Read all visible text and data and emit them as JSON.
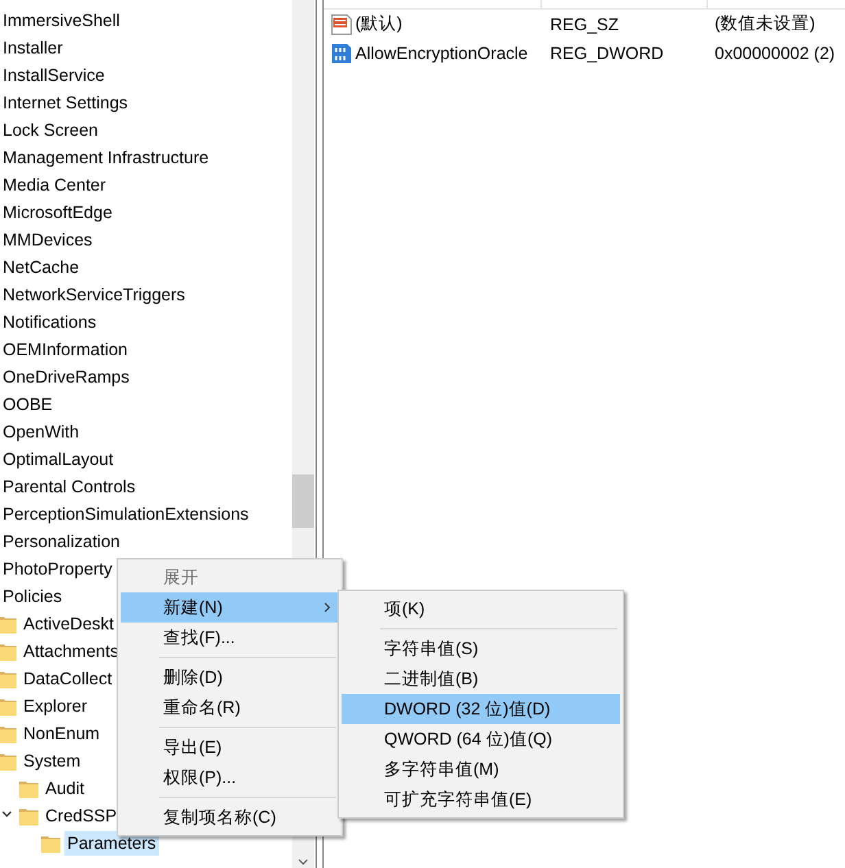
{
  "tree": [
    {
      "label": "ImmersiveShell",
      "selected": false
    },
    {
      "label": "Installer",
      "selected": false
    },
    {
      "label": "InstallService",
      "selected": false
    },
    {
      "label": "Internet Settings",
      "selected": false
    },
    {
      "label": "Lock Screen",
      "selected": false
    },
    {
      "label": "Management Infrastructure",
      "selected": false
    },
    {
      "label": "Media Center",
      "selected": false
    },
    {
      "label": "MicrosoftEdge",
      "selected": false
    },
    {
      "label": "MMDevices",
      "selected": false
    },
    {
      "label": "NetCache",
      "selected": false
    },
    {
      "label": "NetworkServiceTriggers",
      "selected": false
    },
    {
      "label": "Notifications",
      "selected": false
    },
    {
      "label": "OEMInformation",
      "selected": false
    },
    {
      "label": "OneDriveRamps",
      "selected": false
    },
    {
      "label": "OOBE",
      "selected": false
    },
    {
      "label": "OpenWith",
      "selected": false
    },
    {
      "label": "OptimalLayout",
      "selected": false
    },
    {
      "label": "Parental Controls",
      "selected": false
    },
    {
      "label": "PerceptionSimulationExtensions",
      "selected": false
    },
    {
      "label": "Personalization",
      "selected": false
    },
    {
      "label": "PhotoProperty",
      "selected": false
    },
    {
      "label": "Policies",
      "selected": false,
      "children": [
        {
          "label": "ActiveDeskt",
          "selected": false
        },
        {
          "label": "Attachments",
          "selected": false
        },
        {
          "label": "DataCollect",
          "selected": false
        },
        {
          "label": "Explorer",
          "selected": false
        },
        {
          "label": "NonEnum",
          "selected": false
        },
        {
          "label": "System",
          "selected": false,
          "children": [
            {
              "label": "Audit",
              "selected": false
            },
            {
              "label": "CredSSP",
              "selected": false,
              "expanded": true,
              "children": [
                {
                  "label": "Parameters",
                  "selected": true
                }
              ]
            }
          ]
        }
      ]
    }
  ],
  "values": [
    {
      "kind": "string",
      "name": "(默认)",
      "type": "REG_SZ",
      "data": "(数值未设置)"
    },
    {
      "kind": "binary",
      "name": "AllowEncryptionOracle",
      "type": "REG_DWORD",
      "data": "0x00000002 (2)"
    }
  ],
  "context_menu": {
    "items": [
      {
        "label": "展开",
        "disabled": true,
        "selected": false
      },
      {
        "label": "新建(N)",
        "disabled": false,
        "selected": true,
        "submenu": true
      },
      {
        "label": "查找(F)...",
        "disabled": false,
        "selected": false,
        "separator_after": true
      },
      {
        "label": "删除(D)",
        "disabled": false,
        "selected": false
      },
      {
        "label": "重命名(R)",
        "disabled": false,
        "selected": false,
        "separator_after": true
      },
      {
        "label": "导出(E)",
        "disabled": false,
        "selected": false
      },
      {
        "label": "权限(P)...",
        "disabled": false,
        "selected": false,
        "separator_after": true
      },
      {
        "label": "复制项名称(C)",
        "disabled": false,
        "selected": false
      }
    ]
  },
  "submenu": {
    "items": [
      {
        "label": "项(K)",
        "selected": false,
        "separator_after": true
      },
      {
        "label": "字符串值(S)",
        "selected": false
      },
      {
        "label": "二进制值(B)",
        "selected": false
      },
      {
        "label": "DWORD (32 位)值(D)",
        "selected": true
      },
      {
        "label": "QWORD (64 位)值(Q)",
        "selected": false
      },
      {
        "label": "多字符串值(M)",
        "selected": false
      },
      {
        "label": "可扩充字符串值(E)",
        "selected": false
      }
    ]
  }
}
